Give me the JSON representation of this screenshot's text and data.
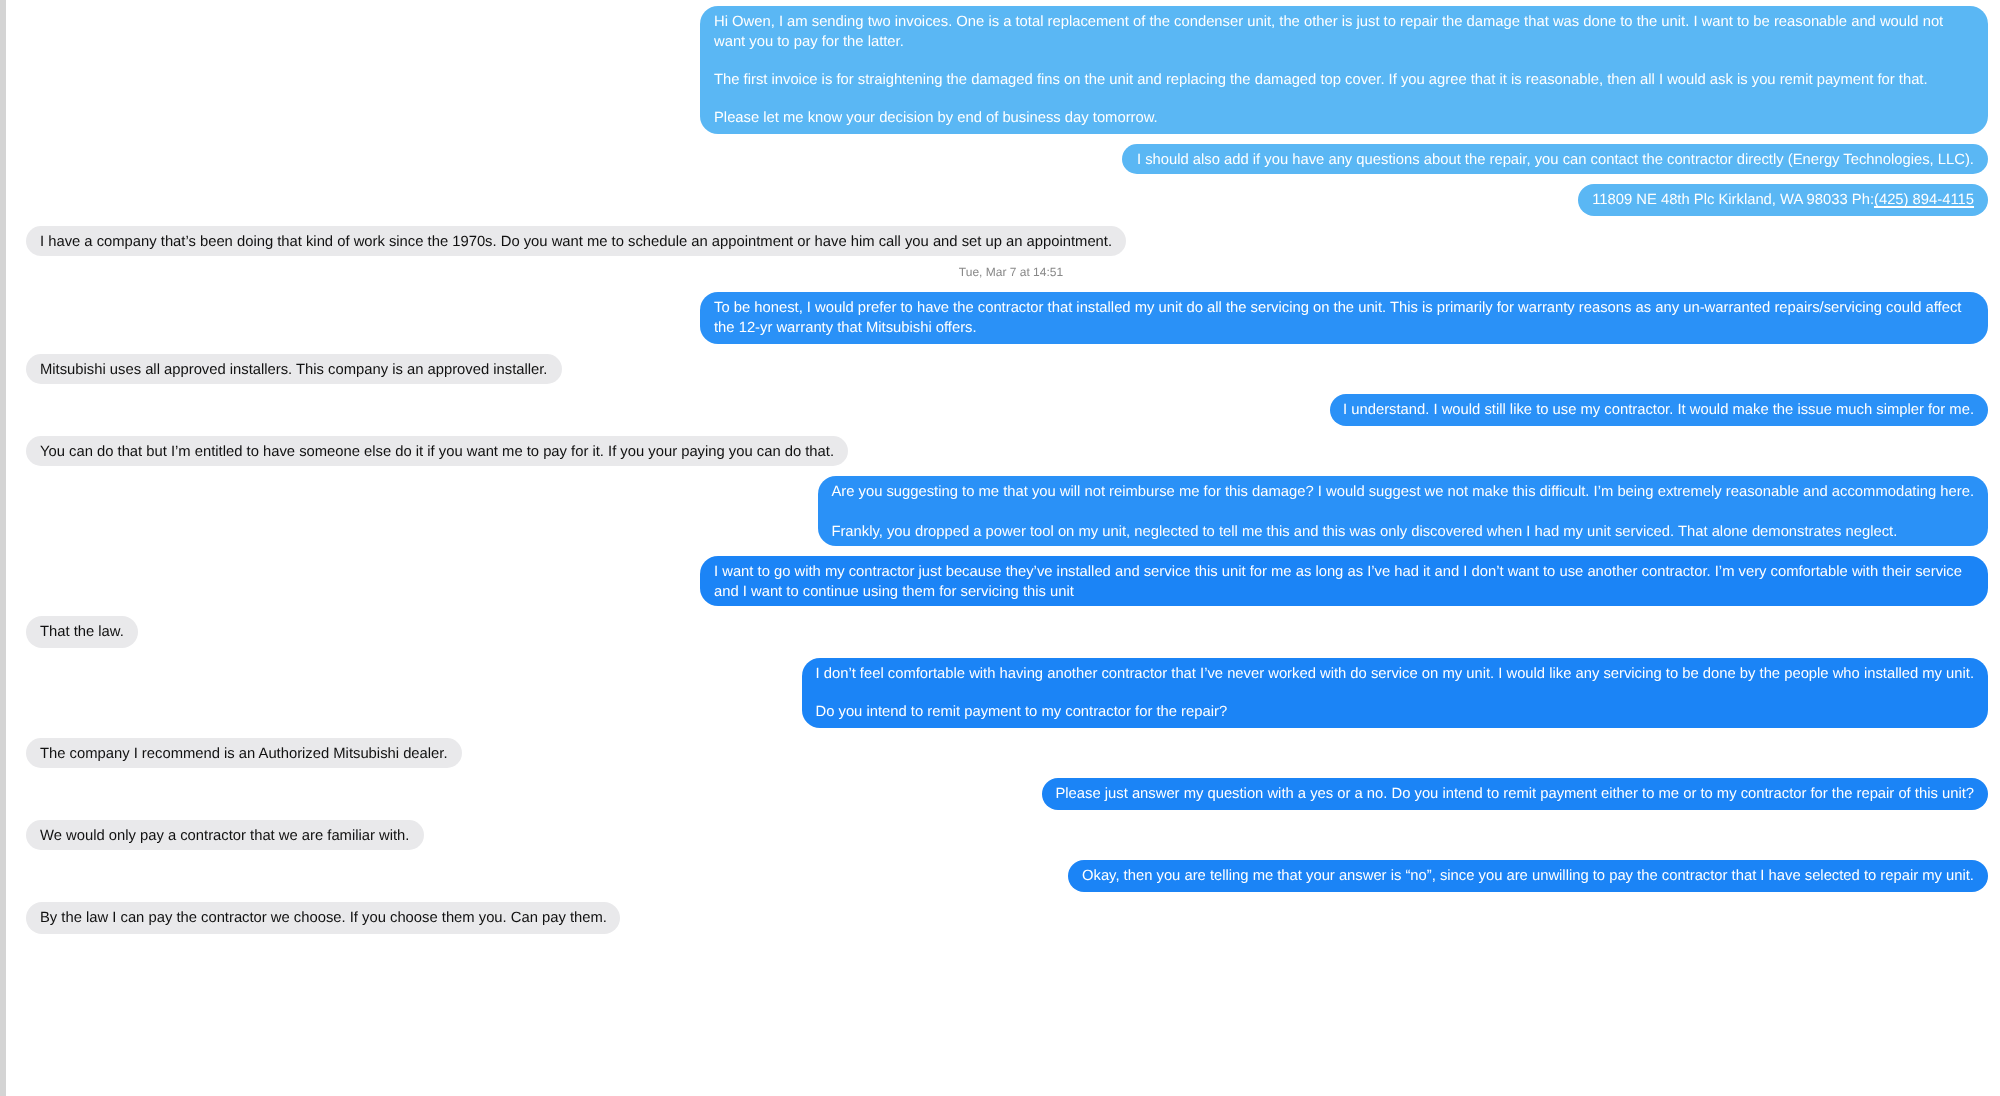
{
  "messages": [
    {
      "kind": "sent",
      "color": "#5ab7f4",
      "paragraphs": [
        "Hi Owen, I am sending two invoices. One is a total replacement of the condenser unit, the other is just to repair the damage that was done to the unit. I want to be reasonable and would not want you to pay for the latter.",
        "The first invoice is for straightening the damaged fins on the unit and replacing the damaged top cover. If you agree that it is reasonable, then all I would ask is you remit payment for that.",
        "Please let me know your decision by end of business day tomorrow."
      ]
    },
    {
      "kind": "sent",
      "color": "#5ab7f4",
      "paragraphs": [
        "I should also add if you have any questions about the repair, you can contact the contractor directly (Energy Technologies, LLC)."
      ]
    },
    {
      "kind": "sent",
      "color": "#5ab7f4",
      "paragraphs": [
        "11809 NE 48th Plc Kirkland, WA 98033 Ph:"
      ],
      "link": "(425) 894-4115"
    },
    {
      "kind": "received",
      "paragraphs": [
        "I have a company that’s been doing that kind of work since the 1970s. Do you want me to schedule an appointment or have him call you and set up an appointment."
      ]
    },
    {
      "kind": "timestamp",
      "text": "Tue, Mar 7 at 14:51"
    },
    {
      "kind": "sent",
      "color": "#2a91f7",
      "paragraphs": [
        "To be honest, I would prefer to have the contractor that installed my unit do all the servicing on the unit. This is primarily for warranty reasons as any un-warranted repairs/servicing could affect the 12-yr warranty that Mitsubishi offers."
      ]
    },
    {
      "kind": "received",
      "paragraphs": [
        "Mitsubishi uses all approved installers. This company is an approved installer."
      ]
    },
    {
      "kind": "sent",
      "color": "#2a91f7",
      "paragraphs": [
        "I understand. I would still like to use my contractor. It would make the issue much simpler for me."
      ]
    },
    {
      "kind": "received",
      "paragraphs": [
        "You can do that but I’m entitled to have someone else do it if you want me to pay for it. If you your paying you can do that."
      ]
    },
    {
      "kind": "sent",
      "color": "#2a91f7",
      "paragraphs": [
        "Are you suggesting to me that you will not reimburse me for this damage? I would suggest we not make this difficult. I’m being extremely reasonable and accommodating here.",
        "Frankly, you dropped a power tool on my unit, neglected to tell me this and this was only discovered when I had my unit serviced. That alone demonstrates neglect."
      ]
    },
    {
      "kind": "sent",
      "color": "#1b84f6",
      "paragraphs": [
        "I want to go with my contractor just because they’ve installed and service this unit for me as long as I’ve had it and I don’t want to use another contractor. I’m very comfortable with their service and I want to continue using them for servicing this unit"
      ]
    },
    {
      "kind": "received",
      "paragraphs": [
        "That the law."
      ]
    },
    {
      "kind": "sent",
      "color": "#1b84f6",
      "paragraphs": [
        "I don’t feel comfortable with having another contractor that I’ve never worked with do service on my unit. I would like any servicing to be done by the people who installed my unit.",
        "Do you intend to remit payment to my contractor for the repair?"
      ]
    },
    {
      "kind": "received",
      "paragraphs": [
        "The company I recommend is an Authorized Mitsubishi dealer."
      ]
    },
    {
      "kind": "sent",
      "color": "#1b84f6",
      "paragraphs": [
        "Please just answer my question with a yes or a no. Do you intend to remit payment either to me or to my contractor for the repair of this unit?"
      ]
    },
    {
      "kind": "received",
      "paragraphs": [
        "We would only pay a contractor that we are familiar with."
      ]
    },
    {
      "kind": "sent",
      "color": "#1b84f6",
      "paragraphs": [
        "Okay, then you are telling me that your answer is “no”, since you are unwilling to pay the contractor that I have selected to repair my unit."
      ]
    },
    {
      "kind": "received",
      "paragraphs": [
        "By the law I can pay the contractor we choose. If you choose them you. Can pay them."
      ]
    }
  ]
}
